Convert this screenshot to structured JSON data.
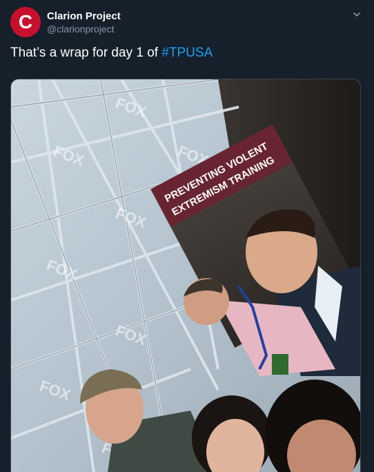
{
  "author": {
    "avatar_letter": "C",
    "display_name": "Clarion Project",
    "handle": "@clarionproject",
    "avatar_color": "#c8102e"
  },
  "tweet": {
    "text_before": "That’s a wrap for day 1 of ",
    "hashtag": "#TPUSA",
    "hashtag_color": "#1da1f2"
  },
  "media": {
    "banner_line1": "PREVENTING VIOLENT",
    "banner_line2": "EXTREMISM TRAINING",
    "backdrop_logo": "FOX"
  },
  "icons": {
    "more_menu": "chevron-down-icon"
  }
}
